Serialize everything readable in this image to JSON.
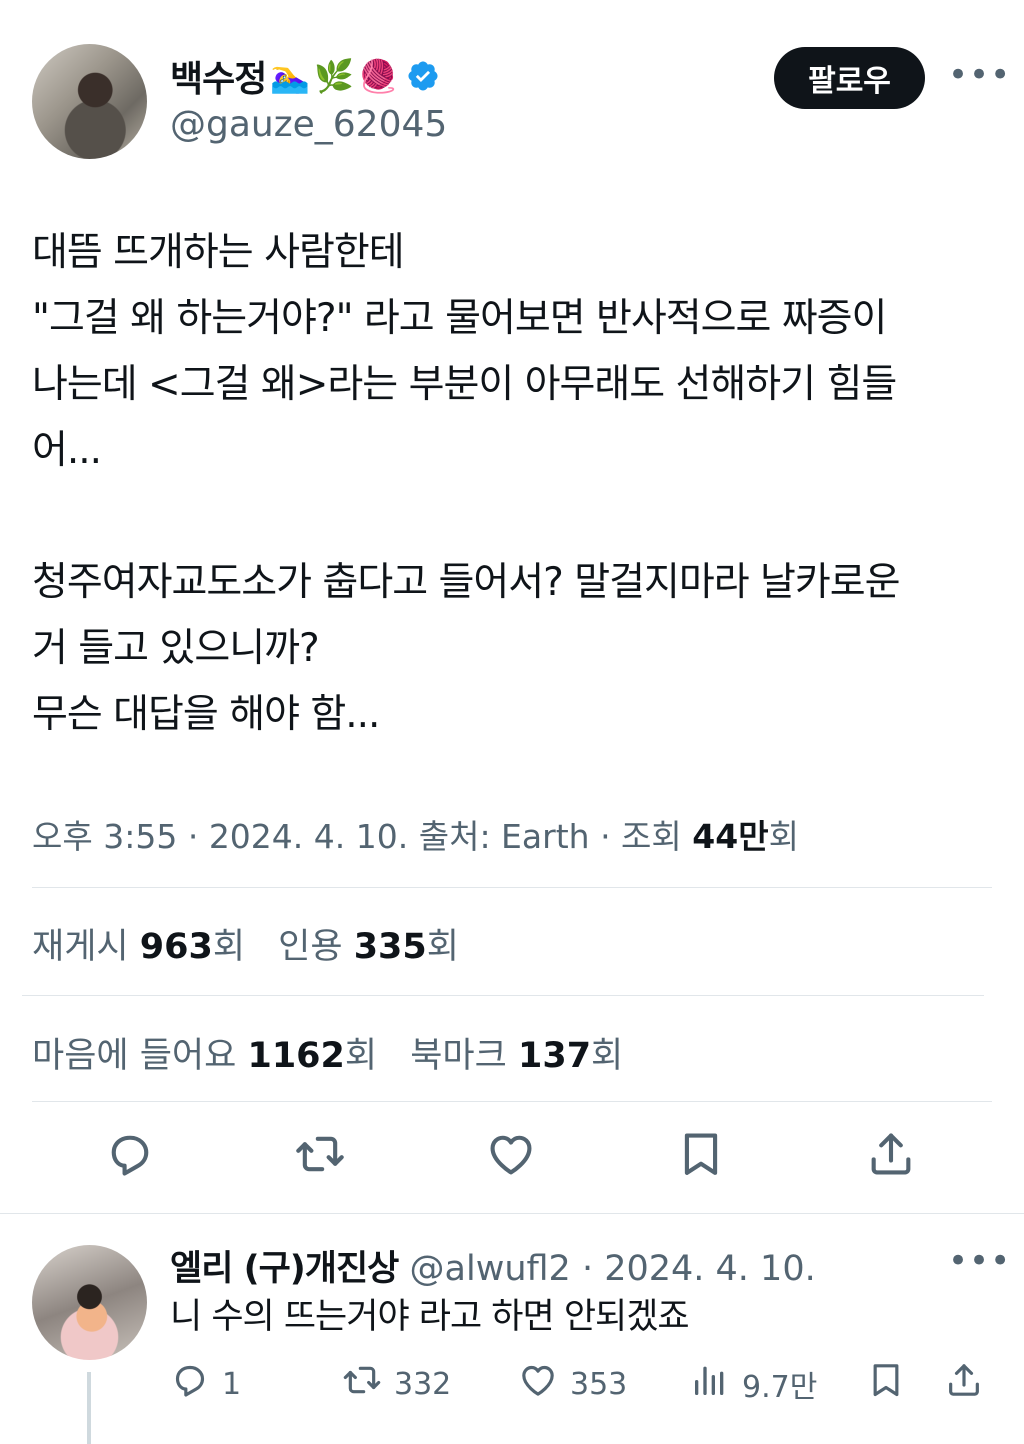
{
  "tweet": {
    "author": {
      "display_name": "백수정",
      "emojis": [
        "🏊‍♀️",
        "🌿",
        "🧶"
      ],
      "verified": true,
      "handle": "@gauze_62045"
    },
    "follow_label": "팔로우",
    "more_label": "•••",
    "body_lines": [
      "대뜸 뜨개하는 사람한테",
      "\"그걸 왜 하는거야?\" 라고 물어보면 반사적으로 짜증이",
      "나는데 <그걸 왜>라는 부분이 아무래도 선해하기 힘들",
      "어...",
      "",
      "청주여자교도소가 춥다고 들어서? 말걸지마라 날카로운",
      "거 들고 있으니까?",
      "무슨 대답을 해야 함..."
    ],
    "meta": {
      "time": "오후 3:55",
      "date": "2024. 4. 10.",
      "source_label": "출처: Earth",
      "views_label": "조회",
      "views_value": "44만",
      "views_suffix": "회"
    },
    "stats": {
      "retweets_label": "재게시",
      "retweets_value": "963",
      "quotes_label": "인용",
      "quotes_value": "335",
      "likes_label": "마음에 들어요",
      "likes_value": "1162",
      "bookmarks_label": "북마크",
      "bookmarks_value": "137",
      "count_suffix": "회"
    }
  },
  "reply": {
    "display_name": "엘리 (구)개진상",
    "handle": "@alwufl2",
    "date": "· 2024. 4. 10.",
    "text": "니 수의 뜨는거야 라고 하면 안되겠죠",
    "more_label": "•••",
    "counts": {
      "replies": "1",
      "retweets": "332",
      "likes": "353",
      "views": "9.7만"
    }
  },
  "colors": {
    "text_primary": "#0f1419",
    "text_secondary": "#536471",
    "verified_blue": "#1d9bf0",
    "follow_bg": "#0f1419",
    "divider": "#e1e6ea"
  },
  "icons": [
    "reply-icon",
    "retweet-icon",
    "like-icon",
    "bookmark-icon",
    "share-icon",
    "views-icon",
    "verified-badge-icon",
    "more-icon"
  ]
}
